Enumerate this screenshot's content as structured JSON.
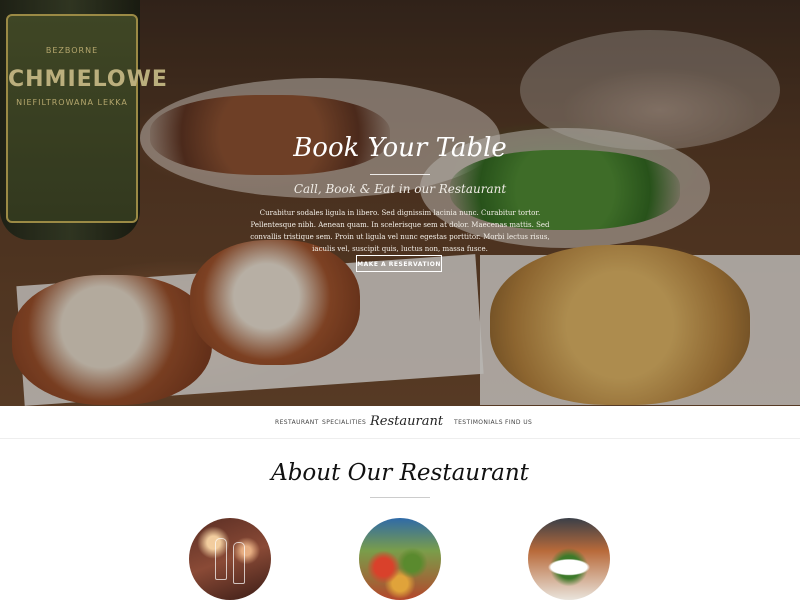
{
  "hero": {
    "bottle_label": {
      "line1": "BEZBORNE",
      "line2": "CHMIELOWE",
      "line3": "NIEFILTROWANA LEKKA"
    },
    "title": "Book Your Table",
    "subtitle": "Call, Book & Eat in our Restaurant",
    "description": "Curabitur sodales ligula in libero. Sed dignissim lacinia nunc. Curabitur tortor. Pellentesque nibh. Aenean quam. In scelerisque sem at dolor. Maecenas mattis. Sed convallis tristique sem. Proin ut ligula vel nunc egestas porttitor. Morbi lectus risus, iaculis vel, suscipit quis, luctus non, massa fusce.",
    "cta_label": "MAKE A RESERVATION"
  },
  "nav": {
    "items": [
      {
        "label": "RESTAURANT"
      },
      {
        "label": "SPECIALITIES"
      },
      {
        "label": "TESTIMONIALS"
      },
      {
        "label": "FIND US"
      }
    ],
    "logo": "Restaurant"
  },
  "about": {
    "title": "About Our Restaurant"
  },
  "colors": {
    "text_dark": "#111111",
    "nav_text": "#444444",
    "hero_text": "#ffffff"
  }
}
